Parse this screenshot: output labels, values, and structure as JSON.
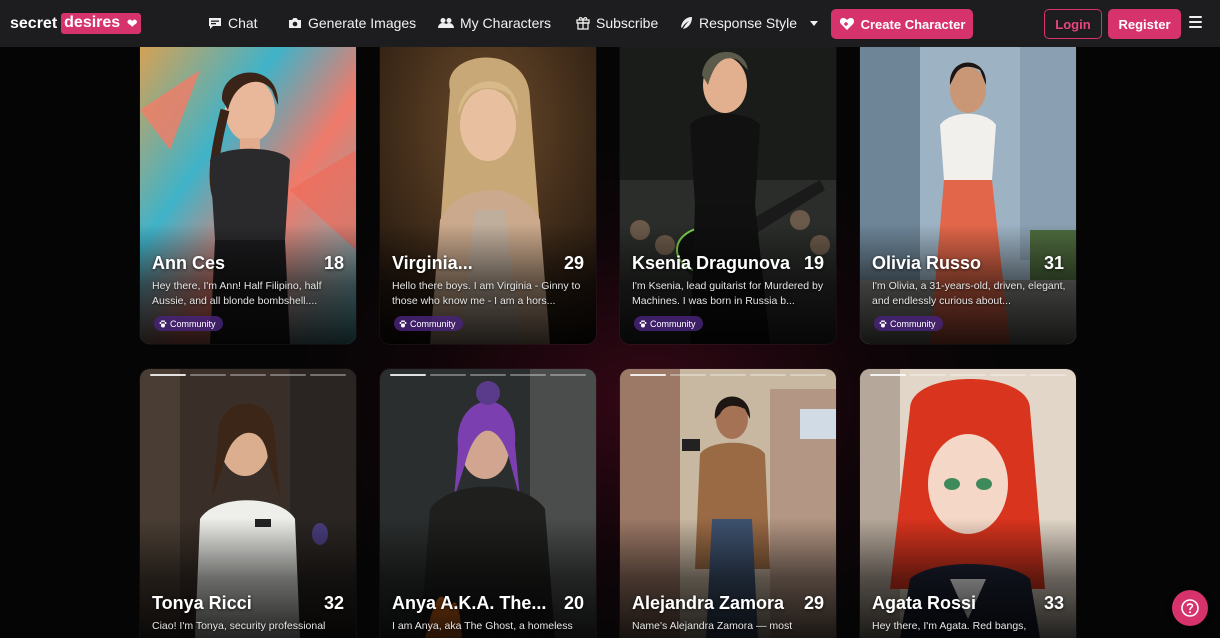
{
  "brand": {
    "word1": "secret",
    "word2": "desires"
  },
  "nav": {
    "chat": "Chat",
    "generate_images": "Generate Images",
    "my_characters": "My Characters",
    "subscribe": "Subscribe",
    "response_style": "Response Style",
    "create_character": "Create Character",
    "login": "Login",
    "register": "Register"
  },
  "colors": {
    "accent": "#d6336c",
    "navbar": "#1d1d1f",
    "background": "#050505",
    "badge": "#46237a"
  },
  "characters": [
    {
      "name": "Ann Ces",
      "age": "18",
      "desc": "Hey there, I'm Ann! Half Filipino, half Aussie, and all blonde bombshell....",
      "badge": "Community"
    },
    {
      "name": "Virginia...",
      "age": "29",
      "desc": "Hello there boys. I am Virginia - Ginny to those who know me - I am a hors...",
      "badge": "Community"
    },
    {
      "name": "Ksenia Dragunova",
      "age": "19",
      "desc": "I'm Ksenia, lead guitarist for Murdered by Machines. I was born in Russia b...",
      "badge": "Community"
    },
    {
      "name": "Olivia Russo",
      "age": "31",
      "desc": "I'm Olivia, a 31-years-old, driven, elegant, and endlessly curious about...",
      "badge": "Community"
    },
    {
      "name": "Tonya Ricci",
      "age": "32",
      "desc": "Ciao! I'm Tonya, security professional"
    },
    {
      "name": "Anya A.K.A. The...",
      "age": "20",
      "desc": "I am Anya, aka The Ghost, a homeless"
    },
    {
      "name": "Alejandra Zamora",
      "age": "29",
      "desc": "Name's Alejandra Zamora — most"
    },
    {
      "name": "Agata Rossi",
      "age": "33",
      "desc": "Hey there, I'm Agata. Red bangs,"
    }
  ]
}
